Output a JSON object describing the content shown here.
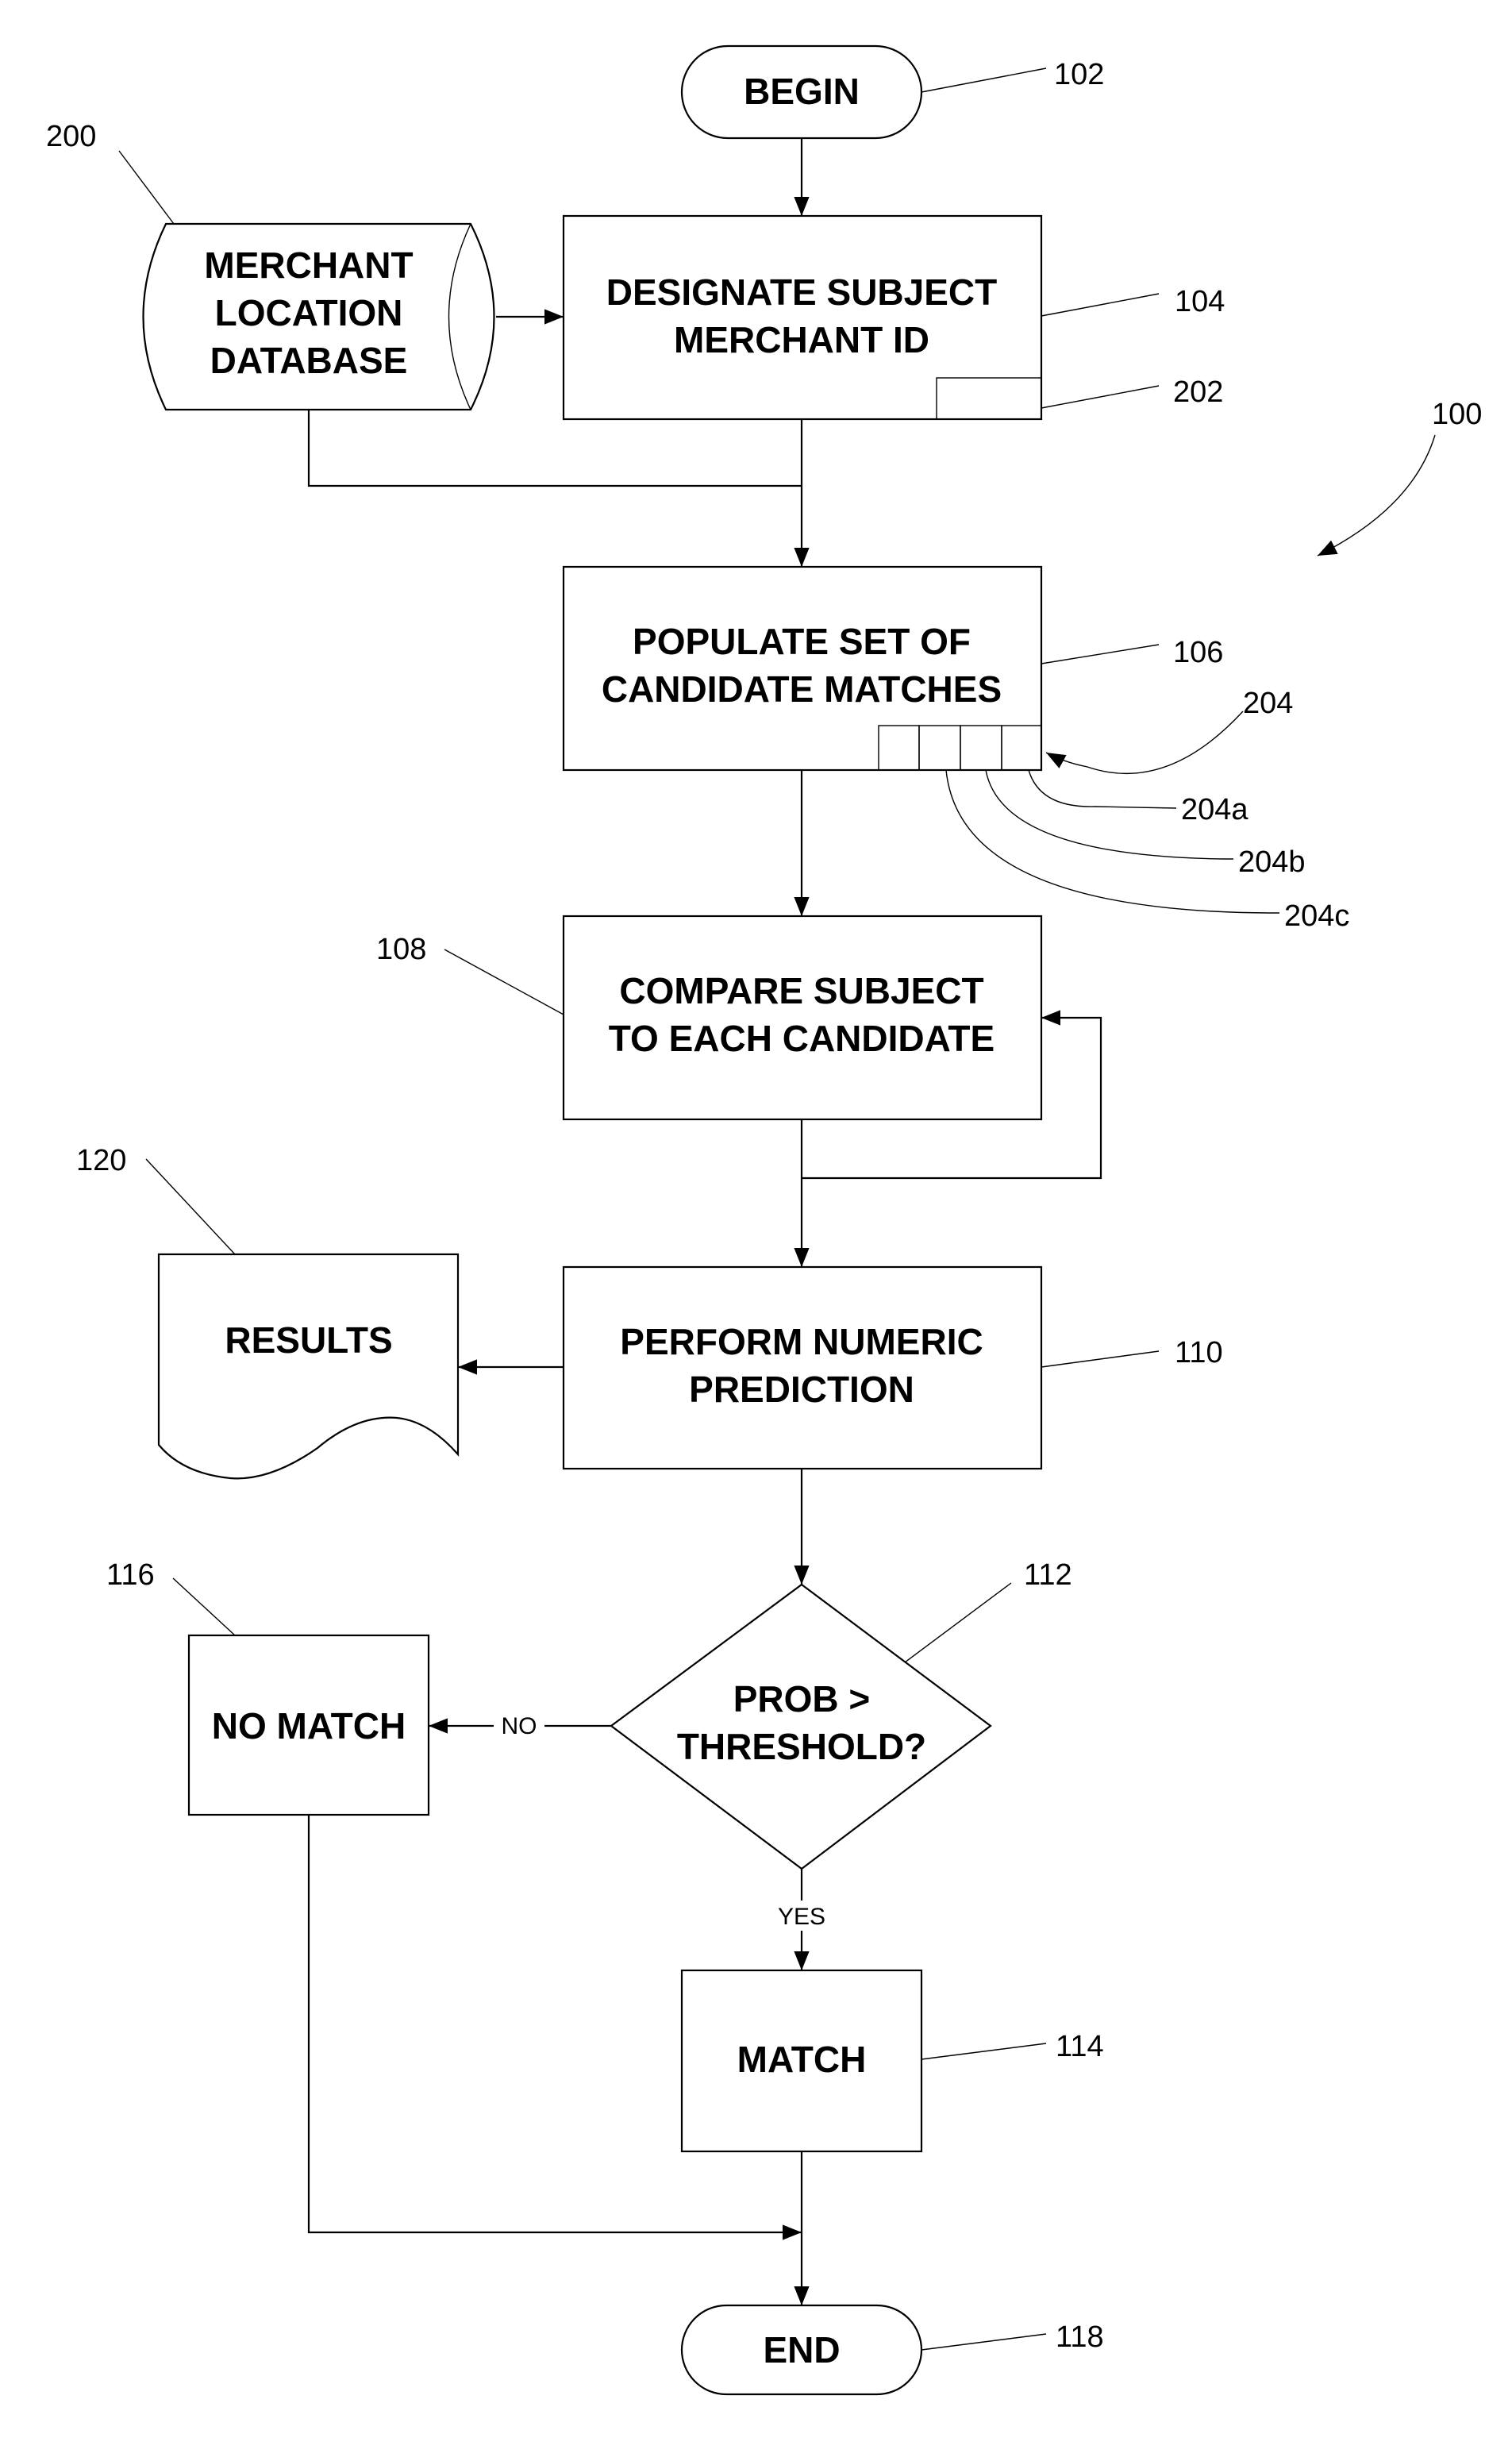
{
  "figure": {
    "ref": "100"
  },
  "nodes": {
    "begin": {
      "ref": "102",
      "lines": [
        "BEGIN"
      ]
    },
    "designate": {
      "ref": "104",
      "lines": [
        "DESIGNATE SUBJECT",
        "MERCHANT ID"
      ],
      "sub_ref": "202"
    },
    "database": {
      "ref": "200",
      "lines": [
        "MERCHANT",
        "LOCATION",
        "DATABASE"
      ]
    },
    "populate": {
      "ref": "106",
      "lines": [
        "POPULATE SET OF",
        "CANDIDATE MATCHES"
      ],
      "sub_ref": "204",
      "cell_refs": [
        "204a",
        "204b",
        "204c"
      ]
    },
    "compare": {
      "ref": "108",
      "lines": [
        "COMPARE SUBJECT",
        "TO EACH CANDIDATE"
      ]
    },
    "predict": {
      "ref": "110",
      "lines": [
        "PERFORM NUMERIC",
        "PREDICTION"
      ]
    },
    "results": {
      "ref": "120",
      "lines": [
        "RESULTS"
      ]
    },
    "decision": {
      "ref": "112",
      "lines": [
        "PROB >",
        "THRESHOLD?"
      ],
      "no_label": "NO",
      "yes_label": "YES"
    },
    "no_match": {
      "ref": "116",
      "lines": [
        "NO MATCH"
      ]
    },
    "match": {
      "ref": "114",
      "lines": [
        "MATCH"
      ]
    },
    "end": {
      "ref": "118",
      "lines": [
        "END"
      ]
    }
  }
}
